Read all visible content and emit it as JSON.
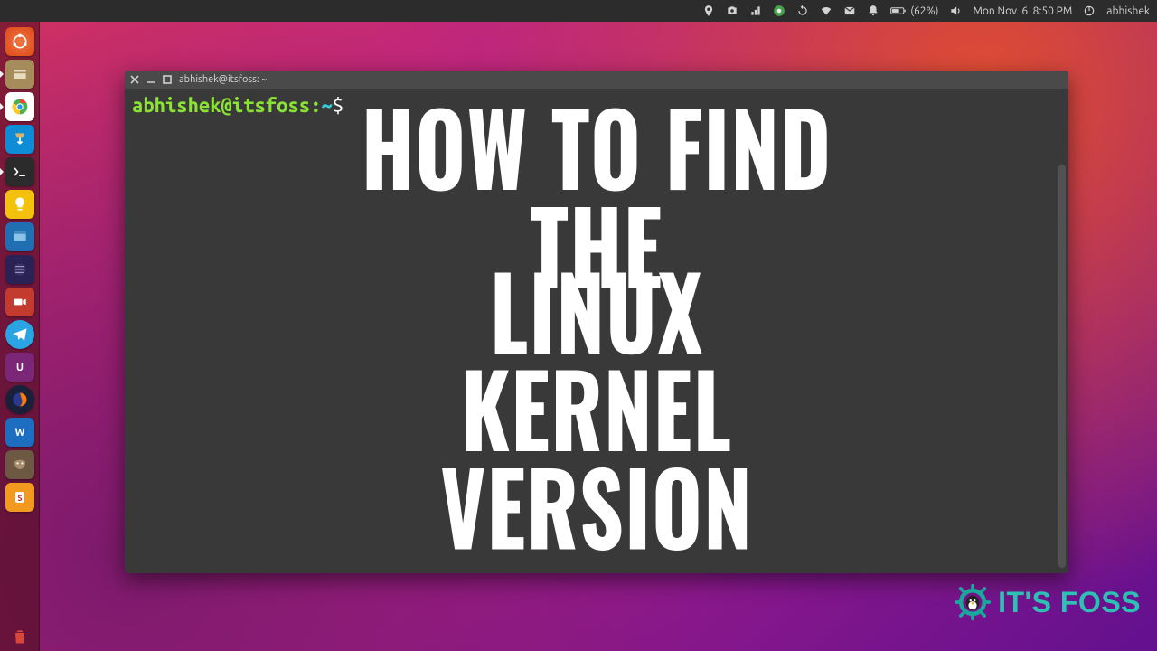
{
  "menubar": {
    "battery": "(62%)",
    "clock": "Mon Nov  6  8:50 PM",
    "user": "abhishek"
  },
  "launcher": {
    "items": [
      {
        "name": "dash",
        "active": false
      },
      {
        "name": "files",
        "active": true
      },
      {
        "name": "chrome",
        "active": true
      },
      {
        "name": "software-updater",
        "active": false
      },
      {
        "name": "terminal",
        "active": true
      },
      {
        "name": "lightbulb",
        "active": false
      },
      {
        "name": "screenshot",
        "active": false
      },
      {
        "name": "eclipse",
        "active": false
      },
      {
        "name": "recorder",
        "active": false
      },
      {
        "name": "telegram",
        "active": false
      },
      {
        "name": "unity-tweak",
        "active": false
      },
      {
        "name": "firefox",
        "active": false
      },
      {
        "name": "wps",
        "active": false
      },
      {
        "name": "gimp",
        "active": false
      },
      {
        "name": "sublime",
        "active": false
      }
    ],
    "trash": "trash"
  },
  "terminal": {
    "title": "abhishek@itsfoss: ~",
    "prompt_user_host": "abhishek@itsfoss",
    "prompt_colon": ":",
    "prompt_cwd": "~",
    "prompt_symbol": "$"
  },
  "overlay": {
    "line1": "HOW TO FIND THE",
    "line2": "LINUX KERNEL VERSION"
  },
  "brand": {
    "text": "IT'S FOSS"
  }
}
